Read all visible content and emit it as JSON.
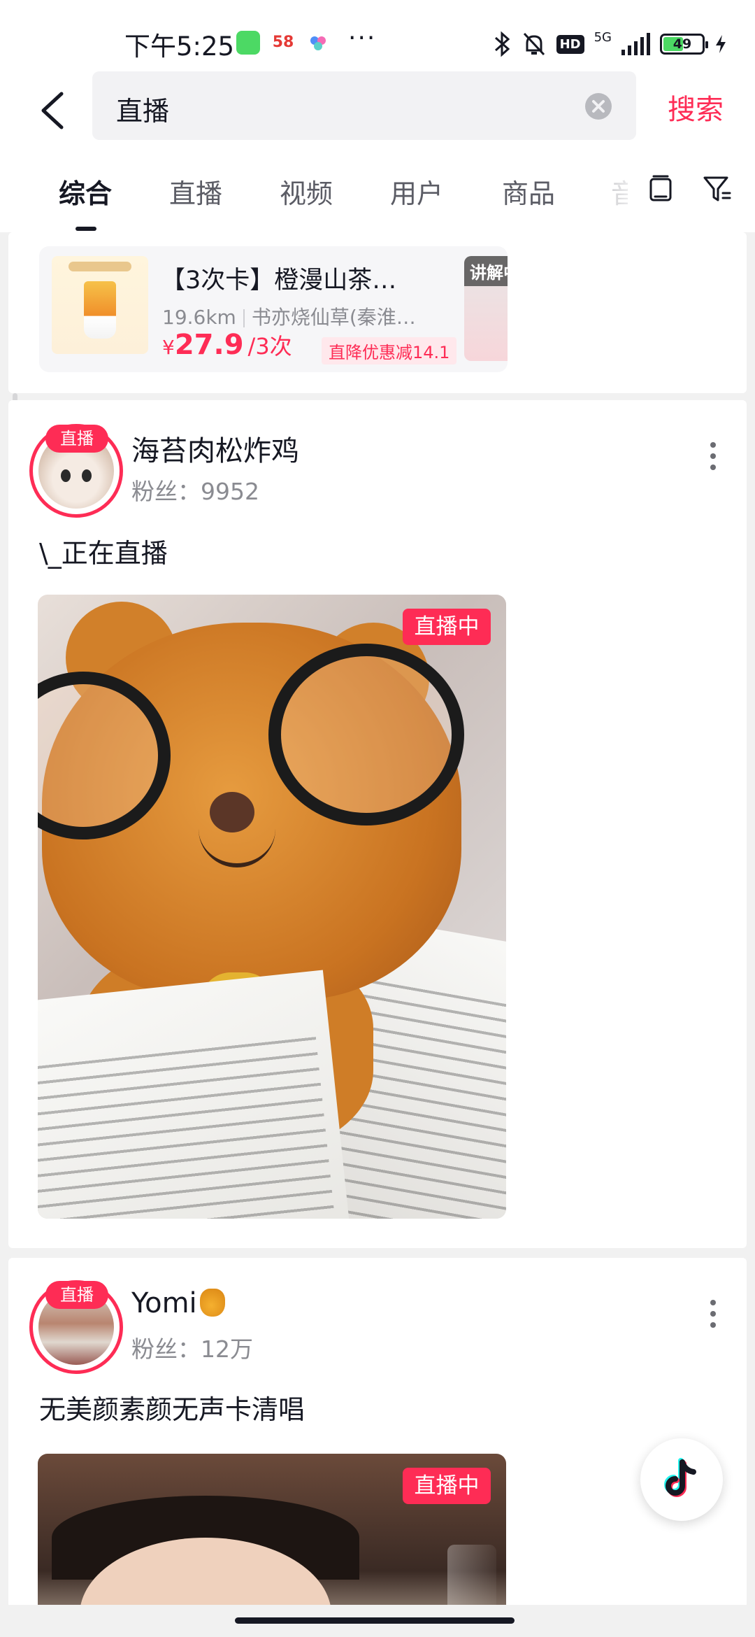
{
  "status_bar": {
    "time": "下午5:25",
    "app2_label": "58",
    "overflow": "···",
    "hd_label": "HD",
    "network": "5G",
    "battery": "49"
  },
  "search": {
    "query": "直播",
    "submit_label": "搜索"
  },
  "tabs": [
    {
      "label": "综合",
      "active": true
    },
    {
      "label": "直播",
      "active": false
    },
    {
      "label": "视频",
      "active": false
    },
    {
      "label": "用户",
      "active": false
    },
    {
      "label": "商品",
      "active": false
    },
    {
      "label": "音",
      "active": false
    }
  ],
  "product": {
    "title": "【3次卡】橙漫山茶…",
    "distance": "19.6km",
    "shop": "书亦烧仙草(秦淮…",
    "price_symbol": "¥",
    "price": "27.9",
    "unit": "/3次",
    "discount": "直降优惠减14.1",
    "side_label": "讲解中"
  },
  "results": [
    {
      "badge": "直播",
      "name": "海苔肉松炸鸡",
      "fans": "粉丝：9952",
      "text": "\\_正在直播",
      "live_tag": "直播中"
    },
    {
      "badge": "直播",
      "name": "Yomi",
      "fans": "粉丝：12万",
      "text": "无美颜素颜无声卡清唱",
      "live_tag": "直播中"
    }
  ],
  "colors": {
    "accent": "#fe2c55",
    "text": "#161823",
    "secondary_text": "#8a8b91",
    "background": "#f1f1f1"
  },
  "icons": [
    "back-icon",
    "clear-icon",
    "tablet-icon",
    "filter-icon",
    "more-icon",
    "tiktok-icon"
  ]
}
